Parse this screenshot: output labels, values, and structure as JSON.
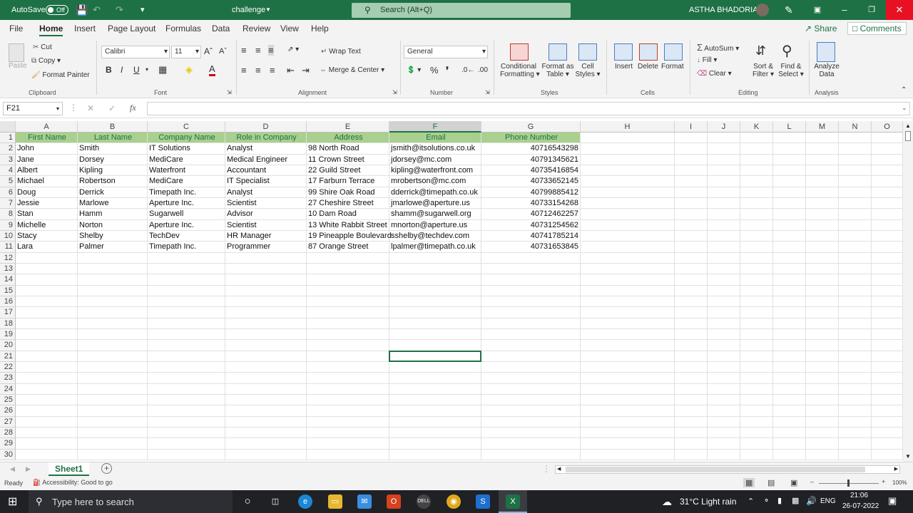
{
  "titlebar": {
    "autosave_label": "AutoSave",
    "autosave_state": "Off",
    "filename": "challenge",
    "search_placeholder": "Search (Alt+Q)",
    "user": "ASTHA BHADORIA"
  },
  "menu": {
    "tabs": [
      "File",
      "Home",
      "Insert",
      "Page Layout",
      "Formulas",
      "Data",
      "Review",
      "View",
      "Help"
    ],
    "active": "Home",
    "share": "Share",
    "comments": "Comments"
  },
  "ribbon": {
    "clipboard": {
      "paste": "Paste",
      "cut": "Cut",
      "copy": "Copy",
      "format_painter": "Format Painter",
      "group": "Clipboard"
    },
    "font": {
      "name": "Calibri",
      "size": "11",
      "group": "Font"
    },
    "alignment": {
      "wrap": "Wrap Text",
      "merge": "Merge & Center",
      "group": "Alignment"
    },
    "number": {
      "format": "General",
      "group": "Number"
    },
    "styles": {
      "conditional": "Conditional",
      "conditional2": "Formatting",
      "format_table": "Format as",
      "format_table2": "Table",
      "cell_styles": "Cell",
      "cell_styles2": "Styles",
      "group": "Styles"
    },
    "cells": {
      "insert": "Insert",
      "delete": "Delete",
      "format": "Format",
      "group": "Cells"
    },
    "editing": {
      "autosum": "AutoSum",
      "fill": "Fill",
      "clear": "Clear",
      "sort": "Sort &",
      "sort2": "Filter",
      "find": "Find &",
      "find2": "Select",
      "group": "Editing"
    },
    "analysis": {
      "analyze": "Analyze",
      "analyze2": "Data",
      "group": "Analysis"
    }
  },
  "formula_bar": {
    "name_box": "F21",
    "fx": "fx",
    "value": ""
  },
  "columns": [
    "A",
    "B",
    "C",
    "D",
    "E",
    "F",
    "G",
    "H",
    "I",
    "J",
    "K",
    "L",
    "M",
    "N",
    "O"
  ],
  "selected_column": "F",
  "headers": [
    "First Name",
    "Last Name",
    "Company Name",
    "Role in Company",
    "Address",
    "Email",
    "Phone Number"
  ],
  "rows": [
    [
      "John",
      "Smith",
      "IT Solutions",
      "Analyst",
      "98 North Road",
      "jsmith@itsolutions.co.uk",
      "40716543298"
    ],
    [
      "Jane",
      "Dorsey",
      "MediCare",
      "Medical Engineer",
      "11 Crown Street",
      "jdorsey@mc.com",
      "40791345621"
    ],
    [
      "Albert",
      "Kipling",
      "Waterfront",
      "Accountant",
      "22 Guild Street",
      "kipling@waterfront.com",
      "40735416854"
    ],
    [
      "Michael",
      "Robertson",
      "MediCare",
      "IT Specialist",
      "17 Farburn Terrace",
      "mrobertson@mc.com",
      "40733652145"
    ],
    [
      "Doug",
      "Derrick",
      "Timepath Inc.",
      "Analyst",
      "99 Shire Oak Road",
      "dderrick@timepath.co.uk",
      "40799885412"
    ],
    [
      "Jessie",
      "Marlowe",
      "Aperture Inc.",
      "Scientist",
      "27 Cheshire Street",
      "jmarlowe@aperture.us",
      "40733154268"
    ],
    [
      "Stan",
      "Hamm",
      "Sugarwell",
      "Advisor",
      "10 Dam Road",
      "shamm@sugarwell.org",
      "40712462257"
    ],
    [
      "Michelle",
      "Norton",
      "Aperture Inc.",
      "Scientist",
      "13 White Rabbit Street",
      "mnorton@aperture.us",
      "40731254562"
    ],
    [
      "Stacy",
      "Shelby",
      "TechDev",
      "HR Manager",
      "19 Pineapple Boulevard",
      "sshelby@techdev.com",
      "40741785214"
    ],
    [
      "Lara",
      "Palmer",
      "Timepath Inc.",
      "Programmer",
      "87 Orange Street",
      "lpalmer@timepath.co.uk",
      "40731653845"
    ]
  ],
  "row_count": 30,
  "sheet": {
    "name": "Sheet1"
  },
  "status": {
    "ready": "Ready",
    "accessibility": "Accessibility: Good to go",
    "zoom": "100%"
  },
  "taskbar": {
    "search": "Type here to search",
    "weather": "31°C  Light rain",
    "lang": "ENG",
    "time": "21:06",
    "date": "26-07-2022"
  },
  "colors": {
    "excel_green": "#1e7145",
    "header_fill": "#a9d08e"
  }
}
